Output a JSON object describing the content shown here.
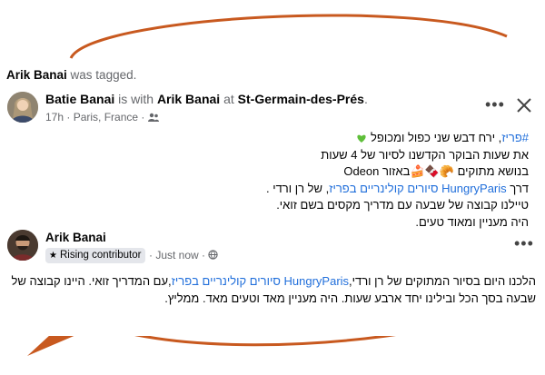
{
  "tag_line": {
    "name": "Arik Banai",
    "suffix": "was tagged."
  },
  "post": {
    "author": "Batie Banai",
    "with_word": "is with",
    "tagged": "Arik Banai",
    "at_word": "at",
    "location": "St-Germain-des-Prés",
    "period": ".",
    "time": "17h",
    "place": "Paris, France",
    "lines": {
      "l1_hashtag": "#פריז",
      "l1_rest": ", ירח דבש שני כפול ומכופל",
      "l2": "את שעות הבוקר הקדשנו לסיור של 4 שעות",
      "l3": "בנושא מתוקים 🥐🍫🍰באזור Odeon",
      "l4_pre": "דרך",
      "l4_link": "HungryParis סיורים קולינריים בפריז",
      "l4_post": ", של רן ורדי .",
      "l5": "טיילנו קבוצה של שבעה עם מדריך מקסים בשם זואי.",
      "l6": "היה מעניין ומאוד טעים."
    }
  },
  "comment": {
    "author": "Arik Banai",
    "badge": "Rising contributor",
    "time": "Just now",
    "line1_pre": "הלכנו היום בסיור המתוקים של רן ורדי,",
    "line1_link": "HungryParis סיורים קולינריים בפריז",
    "line1_post": ",עם המדריך זואי. היינו קבוצה של",
    "line2": "שבעה בסך הכל ובילינו יחד ארבע שעות. היה מעניין מאד וטעים מאד. ממליץ."
  },
  "colors": {
    "accent_orange": "#c8591f",
    "link": "#216fdb",
    "heart": "#5fbf3a"
  },
  "icons": [
    "more-options-icon",
    "close-icon",
    "friends-audience-icon",
    "public-globe-icon",
    "star-icon",
    "green-heart-icon"
  ]
}
